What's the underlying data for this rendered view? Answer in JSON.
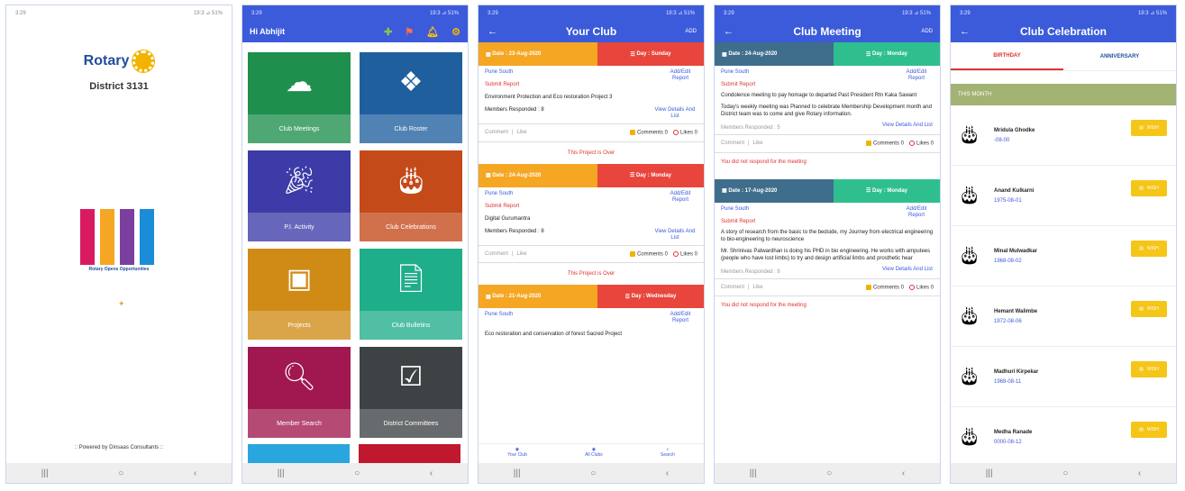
{
  "status_time": "3:29",
  "status_right": "19:3 ⊿ 51%",
  "screen1": {
    "brand": "Rotary",
    "district": "District 3131",
    "doors_caption": "Rotary Opens Opportunities",
    "powered": ":: Powered by Dinsaas Consultants ::"
  },
  "screen2": {
    "greeting": "Hi Abhijit",
    "tiles": [
      {
        "label": "Club Meetings",
        "color": "#1e8f4d",
        "icon": "group-icon"
      },
      {
        "label": "Club Roster",
        "color": "#1f5f9e",
        "icon": "roster-icon"
      },
      {
        "label": "P.I. Activity",
        "color": "#3c3ba8",
        "icon": "party-popper-icon"
      },
      {
        "label": "Club Celebrations",
        "color": "#c44a1a",
        "icon": "cake-icon"
      },
      {
        "label": "Projects",
        "color": "#d08b17",
        "icon": "presentation-icon"
      },
      {
        "label": "Club Bulletins",
        "color": "#1fae8a",
        "icon": "pdf-icon"
      },
      {
        "label": "Member Search",
        "color": "#a0184f",
        "icon": "user-search-icon"
      },
      {
        "label": "District Committees",
        "color": "#3d4245",
        "icon": "checklist-icon"
      }
    ]
  },
  "screen3": {
    "title": "Your Club",
    "add": "ADD",
    "projects": [
      {
        "date": "Date : 23-Aug-2020",
        "day": "Day : Sunday",
        "club": "Pune South",
        "edit": "Add/Edit Report",
        "submit": "Submit Report",
        "desc": "Environment Protection and Eco restoration Project 3",
        "members": "Members Responded : 8",
        "view": "View Details And List",
        "comment": "Comment",
        "like": "Like",
        "comments": "Comments 0",
        "likes": "Likes 0",
        "over": "This Project is Over"
      },
      {
        "date": "Date : 24-Aug-2020",
        "day": "Day : Monday",
        "club": "Pune South",
        "edit": "Add/Edit Report",
        "submit": "Submit Report",
        "desc": "Digital Gurumantra",
        "members": "Members Responded : 8",
        "view": "View Details And List",
        "comment": "Comment",
        "like": "Like",
        "comments": "Comments 0",
        "likes": "Likes 0",
        "over": "This Project is Over"
      },
      {
        "date": "Date : 21-Aug-2020",
        "day": "Day : Wednesday",
        "club": "Pune South",
        "edit": "Add/Edit Report",
        "desc": "Eco restoration and conservation of forest Sacred Project"
      }
    ],
    "nav": [
      "Your Club",
      "All Clubs",
      "Search"
    ]
  },
  "screen4": {
    "title": "Club Meeting",
    "add": "ADD",
    "meetings": [
      {
        "date": "Date : 24-Aug-2020",
        "day": "Day : Monday",
        "club": "Pune South",
        "edit": "Add/Edit Report",
        "submit": "Submit Report",
        "desc1": "Condolence meeting to pay homage to departed Past President Rtn Kaka Sawant",
        "desc2": "Today's weekly meeting was Planned to celebrate Membership Development month and District team was to come and give Rotary information.",
        "members": "Members Responded : 5",
        "view": "View Details And List",
        "comment": "Comment",
        "like": "Like",
        "comments": "Comments 0",
        "likes": "Likes 0",
        "note": "You did not respond for the meeting"
      },
      {
        "date": "Date : 17-Aug-2020",
        "day": "Day : Monday",
        "club": "Pune South",
        "edit": "Add/Edit Report",
        "submit": "Submit Report",
        "desc1": "A story of research from the basic to the bedside, my Journey from electrical engineering to bio-engineering to neuroscience",
        "desc2": "Mr. Shrinivas Patwardhan is doing his PHD in bio engineering. He works with amputees (people who have lost limbs) to try and design artificial limbs and prosthetic hear",
        "members": "Members Responded : 8",
        "view": "View Details And List",
        "comment": "Comment",
        "like": "Like",
        "comments": "Comments 0",
        "likes": "Likes 0",
        "note": "You did not respond for the meeting"
      }
    ]
  },
  "screen5": {
    "title": "Club Celebration",
    "tab1": "BIRTHDAY",
    "tab2": "ANNIVERSARY",
    "month": "THIS MONTH",
    "wish": "WISH",
    "people": [
      {
        "name": "Mridula Ghodke",
        "date": "-08-00"
      },
      {
        "name": "Anand Kulkarni",
        "date": "1975-08-01"
      },
      {
        "name": "Minal Mulwadkar",
        "date": "1968-08-02"
      },
      {
        "name": "Hemant Walimbe",
        "date": "1972-08-06"
      },
      {
        "name": "Madhuri Kirpekar",
        "date": "1968-08-11"
      },
      {
        "name": "Medha Ranade",
        "date": "0000-08-12"
      }
    ]
  }
}
